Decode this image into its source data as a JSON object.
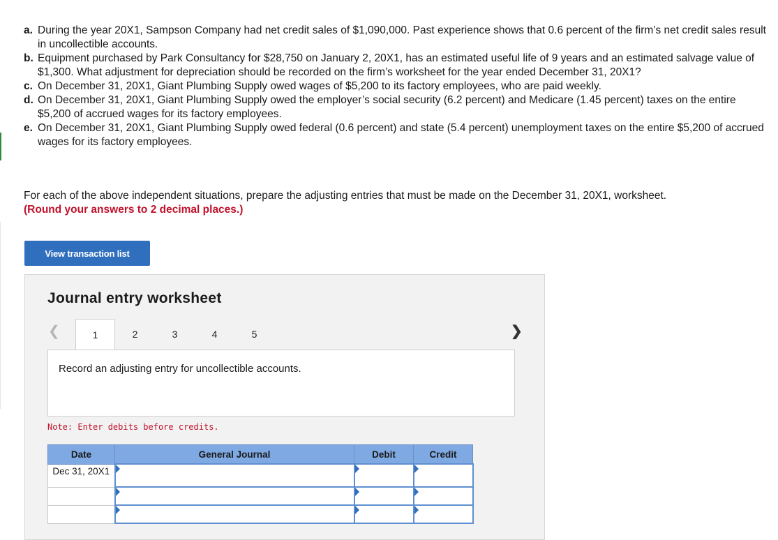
{
  "questions": [
    {
      "letter": "a.",
      "text": "During the year 20X1, Sampson Company had net credit sales of $1,090,000. Past experience shows that 0.6 percent of the firm’s net credit sales result in uncollectible accounts."
    },
    {
      "letter": "b.",
      "text": "Equipment purchased by Park Consultancy for $28,750 on January 2, 20X1, has an estimated useful life of 9 years and an estimated salvage value of $1,300. What adjustment for depreciation should be recorded on the firm’s worksheet for the year ended December 31, 20X1?"
    },
    {
      "letter": "c.",
      "text": "On December 31, 20X1, Giant Plumbing Supply owed wages of $5,200 to its factory employees, who are paid weekly."
    },
    {
      "letter": "d.",
      "text": "On December 31, 20X1, Giant Plumbing Supply owed the employer’s social security (6.2 percent) and Medicare (1.45 percent) taxes on the entire $5,200 of accrued wages for its factory employees."
    },
    {
      "letter": "e.",
      "text": "On December 31, 20X1, Giant Plumbing Supply owed federal (0.6 percent) and state (5.4 percent) unemployment taxes on the entire $5,200 of accrued wages for its factory employees."
    }
  ],
  "instruction": {
    "text": "For each of the above independent situations, prepare the adjusting entries that must be made on the December 31, 20X1, worksheet.",
    "round_note": "(Round your answers to 2 decimal places.)"
  },
  "view_button": "View transaction list",
  "worksheet": {
    "title": "Journal entry worksheet",
    "tabs": [
      "1",
      "2",
      "3",
      "4",
      "5"
    ],
    "active_tab": "1",
    "prompt": "Record an adjusting entry for uncollectible accounts.",
    "note": "Note: Enter debits before credits.",
    "columns": {
      "date": "Date",
      "journal": "General Journal",
      "debit": "Debit",
      "credit": "Credit"
    },
    "rows": [
      {
        "date": "Dec 31, 20X1",
        "journal": "",
        "debit": "",
        "credit": ""
      },
      {
        "date": "",
        "journal": "",
        "debit": "",
        "credit": ""
      },
      {
        "date": "",
        "journal": "",
        "debit": "",
        "credit": ""
      }
    ]
  }
}
